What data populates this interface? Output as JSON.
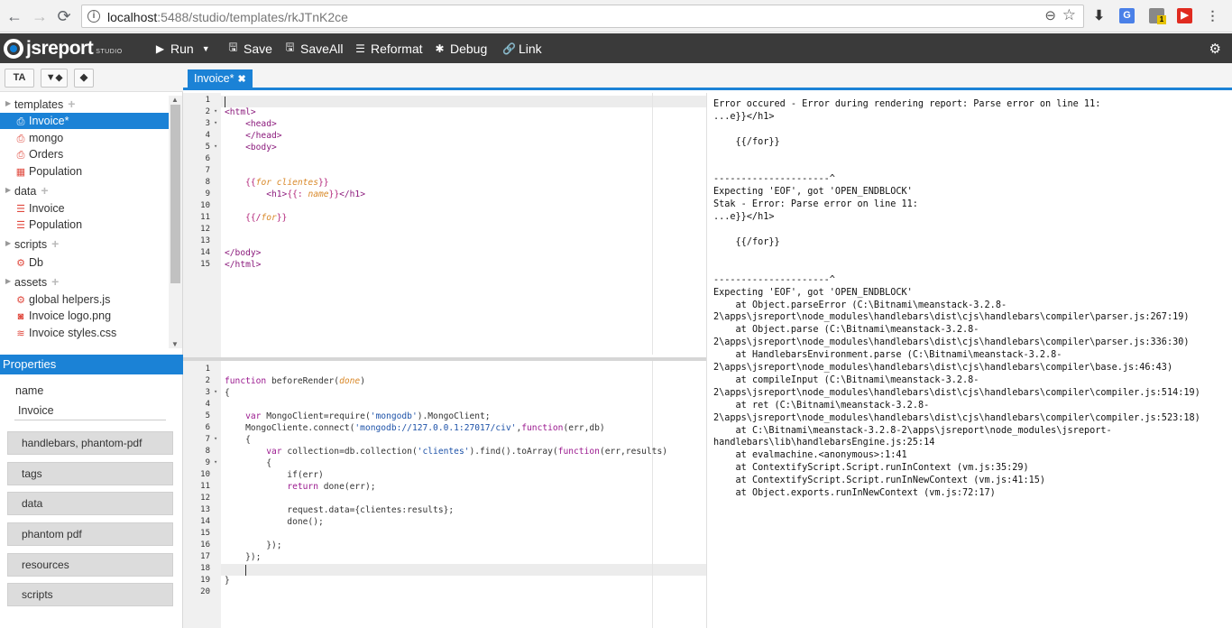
{
  "browser": {
    "back_icon": "←",
    "forward_icon": "→",
    "reload_icon": "⟳",
    "url_host": "localhost",
    "url_rest": ":5488/studio/templates/rkJTnK2ce",
    "info_icon": "i",
    "zoom_icon": "⊖",
    "star_icon": "☆",
    "ext_badge": "1"
  },
  "toolbar": {
    "logo_text": "jsreport",
    "logo_sub": "STUDIO",
    "run_label": "Run",
    "save_label": "Save",
    "saveall_label": "SaveAll",
    "reformat_label": "Reformat",
    "debug_label": "Debug",
    "link_label": "Link"
  },
  "filter_buttons": [
    "TA",
    "T",
    ""
  ],
  "tree": [
    {
      "label": "templates",
      "type": "folder"
    },
    {
      "label": "Invoice*",
      "type": "pdf",
      "selected": true
    },
    {
      "label": "mongo",
      "type": "pdf"
    },
    {
      "label": "Orders",
      "type": "pdf"
    },
    {
      "label": "Population",
      "type": "table"
    },
    {
      "label": "data",
      "type": "folder"
    },
    {
      "label": "Invoice",
      "type": "db"
    },
    {
      "label": "Population",
      "type": "db"
    },
    {
      "label": "scripts",
      "type": "folder"
    },
    {
      "label": "Db",
      "type": "cog"
    },
    {
      "label": "assets",
      "type": "folder"
    },
    {
      "label": "global helpers.js",
      "type": "cogs"
    },
    {
      "label": "Invoice logo.png",
      "type": "camera"
    },
    {
      "label": "Invoice styles.css",
      "type": "css"
    }
  ],
  "properties": {
    "header": "Properties",
    "name_label": "name",
    "name_value": "Invoice",
    "sections": [
      "handlebars, phantom-pdf",
      "tags",
      "data",
      "phantom pdf",
      "resources",
      "scripts"
    ]
  },
  "tab": {
    "label": "Invoice*",
    "close": "✖"
  },
  "template_lines": [
    "",
    "<html>",
    "    <head>",
    "    </head>",
    "    <body>",
    "",
    "",
    "    {{for clientes}}",
    "        <h1>{{: name}}</h1>",
    "",
    "    {{/for}}",
    "",
    "",
    "</body>",
    "</html>"
  ],
  "helper_lines": [
    "",
    "function beforeRender(done)",
    "{",
    "",
    "    var MongoClient=require('mongodb').MongoClient;",
    "    MongoCliente.connect('mongodb://127.0.0.1:27017/civ',function(err,db)",
    "    {",
    "        var collection=db.collection('clientes').find().toArray(function(err,results)",
    "        {",
    "            if(err)",
    "            return done(err);",
    "",
    "            request.data={clientes:results};",
    "            done();",
    "",
    "        });",
    "    });",
    "    ",
    "}",
    ""
  ],
  "preview_text": "Error occured - Error during rendering report: Parse error on line 11:\n...e}}</h1>\n\n    {{/for}}\n\n\n---------------------^\nExpecting 'EOF', got 'OPEN_ENDBLOCK'\nStak - Error: Parse error on line 11:\n...e}}</h1>\n\n    {{/for}}\n\n\n---------------------^\nExpecting 'EOF', got 'OPEN_ENDBLOCK'\n    at Object.parseError (C:\\Bitnami\\meanstack-3.2.8-2\\apps\\jsreport\\node_modules\\handlebars\\dist\\cjs\\handlebars\\compiler\\parser.js:267:19)\n    at Object.parse (C:\\Bitnami\\meanstack-3.2.8-2\\apps\\jsreport\\node_modules\\handlebars\\dist\\cjs\\handlebars\\compiler\\parser.js:336:30)\n    at HandlebarsEnvironment.parse (C:\\Bitnami\\meanstack-3.2.8-2\\apps\\jsreport\\node_modules\\handlebars\\dist\\cjs\\handlebars\\compiler\\base.js:46:43)\n    at compileInput (C:\\Bitnami\\meanstack-3.2.8-2\\apps\\jsreport\\node_modules\\handlebars\\dist\\cjs\\handlebars\\compiler\\compiler.js:514:19)\n    at ret (C:\\Bitnami\\meanstack-3.2.8-2\\apps\\jsreport\\node_modules\\handlebars\\dist\\cjs\\handlebars\\compiler\\compiler.js:523:18)\n    at C:\\Bitnami\\meanstack-3.2.8-2\\apps\\jsreport\\node_modules\\jsreport-handlebars\\lib\\handlebarsEngine.js:25:14\n    at evalmachine.<anonymous>:1:41\n    at ContextifyScript.Script.runInContext (vm.js:35:29)\n    at ContextifyScript.Script.runInNewContext (vm.js:41:15)\n    at Object.exports.runInNewContext (vm.js:72:17)"
}
